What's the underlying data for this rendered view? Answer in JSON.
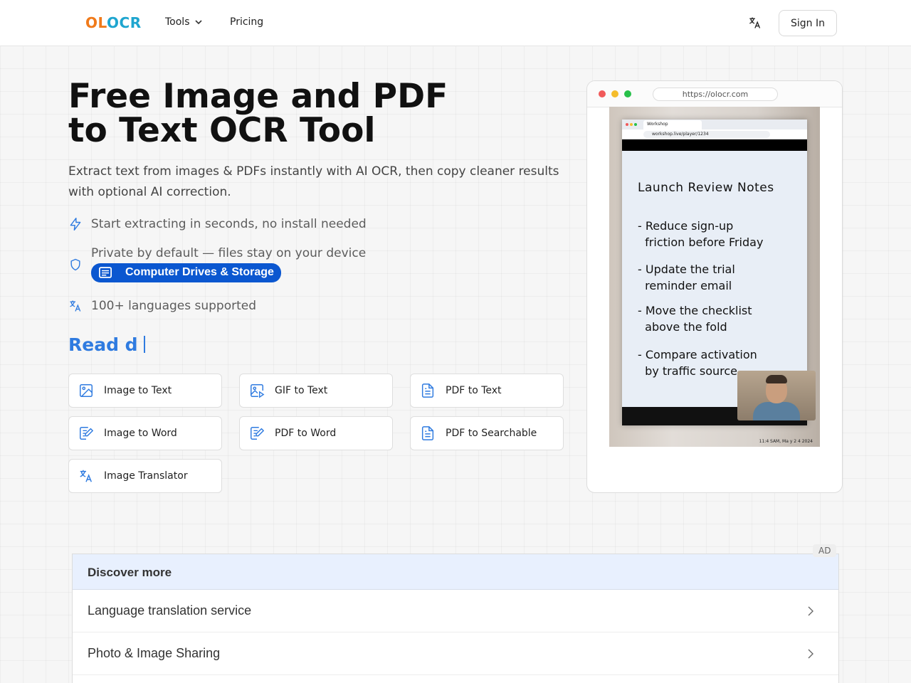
{
  "nav": {
    "logo_part1": "OL",
    "logo_part2": "OCR",
    "tools_label": "Tools",
    "pricing_label": "Pricing",
    "signin_label": "Sign In"
  },
  "hero": {
    "title_line1": "Free Image and PDF",
    "title_line2": "to Text OCR Tool",
    "subtitle": "Extract text from images & PDFs instantly with AI OCR, then copy cleaner results with optional AI correction.",
    "features": [
      {
        "icon": "lightning-icon",
        "text": "Start extracting in seconds, no install needed"
      },
      {
        "icon": "shield-icon",
        "text": "Private by default — files stay on your device"
      },
      {
        "icon": "translate-icon",
        "text": "100+ languages supported"
      }
    ],
    "chip_label": "Computer Drives & Storage",
    "typing_text": "Read d"
  },
  "tools": [
    {
      "label": "Image to Text",
      "icon": "image-icon"
    },
    {
      "label": "GIF to Text",
      "icon": "gif-image-icon"
    },
    {
      "label": "PDF to Text",
      "icon": "document-icon"
    },
    {
      "label": "Image to Word",
      "icon": "edit-document-icon"
    },
    {
      "label": "PDF to Word",
      "icon": "edit-document-icon"
    },
    {
      "label": "PDF to Searchable",
      "icon": "document-icon"
    },
    {
      "label": "Image Translator",
      "icon": "translate-icon"
    }
  ],
  "preview": {
    "url": "https://olocr.com",
    "tab_title": "Workshop",
    "inner_url": "workshop.live/player/1234",
    "note_title": "Launch Review Notes",
    "notes": [
      "- Reduce sign-up\n  friction before Friday",
      "- Update the trial\n  reminder email",
      "- Move the checklist\n  above the fold",
      "- Compare activation\n  by traffic source"
    ],
    "timestamp": "11:4 SAM, Ma y 2 4 2024"
  },
  "ad": {
    "badge": "AD",
    "heading": "Discover more",
    "items": [
      "Language translation service",
      "Photo & Image Sharing"
    ]
  },
  "colors": {
    "brand_orange": "#f07a1a",
    "brand_cyan": "#1ea5cf",
    "accent_blue": "#2f7be0",
    "chip_blue": "#0b57d0"
  }
}
